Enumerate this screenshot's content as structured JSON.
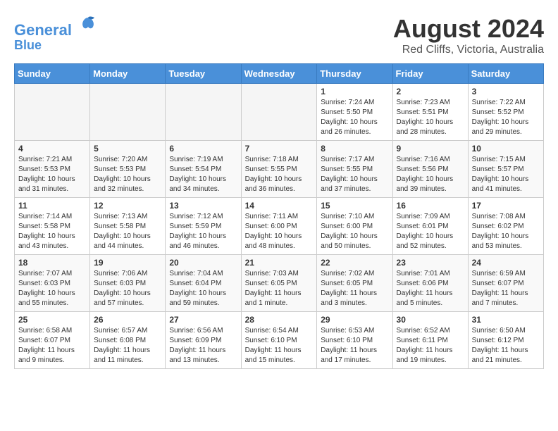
{
  "header": {
    "logo_line1": "General",
    "logo_line2": "Blue",
    "month_year": "August 2024",
    "location": "Red Cliffs, Victoria, Australia"
  },
  "days_of_week": [
    "Sunday",
    "Monday",
    "Tuesday",
    "Wednesday",
    "Thursday",
    "Friday",
    "Saturday"
  ],
  "weeks": [
    [
      {
        "day": "",
        "info": ""
      },
      {
        "day": "",
        "info": ""
      },
      {
        "day": "",
        "info": ""
      },
      {
        "day": "",
        "info": ""
      },
      {
        "day": "1",
        "info": "Sunrise: 7:24 AM\nSunset: 5:50 PM\nDaylight: 10 hours\nand 26 minutes."
      },
      {
        "day": "2",
        "info": "Sunrise: 7:23 AM\nSunset: 5:51 PM\nDaylight: 10 hours\nand 28 minutes."
      },
      {
        "day": "3",
        "info": "Sunrise: 7:22 AM\nSunset: 5:52 PM\nDaylight: 10 hours\nand 29 minutes."
      }
    ],
    [
      {
        "day": "4",
        "info": "Sunrise: 7:21 AM\nSunset: 5:53 PM\nDaylight: 10 hours\nand 31 minutes."
      },
      {
        "day": "5",
        "info": "Sunrise: 7:20 AM\nSunset: 5:53 PM\nDaylight: 10 hours\nand 32 minutes."
      },
      {
        "day": "6",
        "info": "Sunrise: 7:19 AM\nSunset: 5:54 PM\nDaylight: 10 hours\nand 34 minutes."
      },
      {
        "day": "7",
        "info": "Sunrise: 7:18 AM\nSunset: 5:55 PM\nDaylight: 10 hours\nand 36 minutes."
      },
      {
        "day": "8",
        "info": "Sunrise: 7:17 AM\nSunset: 5:55 PM\nDaylight: 10 hours\nand 37 minutes."
      },
      {
        "day": "9",
        "info": "Sunrise: 7:16 AM\nSunset: 5:56 PM\nDaylight: 10 hours\nand 39 minutes."
      },
      {
        "day": "10",
        "info": "Sunrise: 7:15 AM\nSunset: 5:57 PM\nDaylight: 10 hours\nand 41 minutes."
      }
    ],
    [
      {
        "day": "11",
        "info": "Sunrise: 7:14 AM\nSunset: 5:58 PM\nDaylight: 10 hours\nand 43 minutes."
      },
      {
        "day": "12",
        "info": "Sunrise: 7:13 AM\nSunset: 5:58 PM\nDaylight: 10 hours\nand 44 minutes."
      },
      {
        "day": "13",
        "info": "Sunrise: 7:12 AM\nSunset: 5:59 PM\nDaylight: 10 hours\nand 46 minutes."
      },
      {
        "day": "14",
        "info": "Sunrise: 7:11 AM\nSunset: 6:00 PM\nDaylight: 10 hours\nand 48 minutes."
      },
      {
        "day": "15",
        "info": "Sunrise: 7:10 AM\nSunset: 6:00 PM\nDaylight: 10 hours\nand 50 minutes."
      },
      {
        "day": "16",
        "info": "Sunrise: 7:09 AM\nSunset: 6:01 PM\nDaylight: 10 hours\nand 52 minutes."
      },
      {
        "day": "17",
        "info": "Sunrise: 7:08 AM\nSunset: 6:02 PM\nDaylight: 10 hours\nand 53 minutes."
      }
    ],
    [
      {
        "day": "18",
        "info": "Sunrise: 7:07 AM\nSunset: 6:03 PM\nDaylight: 10 hours\nand 55 minutes."
      },
      {
        "day": "19",
        "info": "Sunrise: 7:06 AM\nSunset: 6:03 PM\nDaylight: 10 hours\nand 57 minutes."
      },
      {
        "day": "20",
        "info": "Sunrise: 7:04 AM\nSunset: 6:04 PM\nDaylight: 10 hours\nand 59 minutes."
      },
      {
        "day": "21",
        "info": "Sunrise: 7:03 AM\nSunset: 6:05 PM\nDaylight: 11 hours\nand 1 minute."
      },
      {
        "day": "22",
        "info": "Sunrise: 7:02 AM\nSunset: 6:05 PM\nDaylight: 11 hours\nand 3 minutes."
      },
      {
        "day": "23",
        "info": "Sunrise: 7:01 AM\nSunset: 6:06 PM\nDaylight: 11 hours\nand 5 minutes."
      },
      {
        "day": "24",
        "info": "Sunrise: 6:59 AM\nSunset: 6:07 PM\nDaylight: 11 hours\nand 7 minutes."
      }
    ],
    [
      {
        "day": "25",
        "info": "Sunrise: 6:58 AM\nSunset: 6:07 PM\nDaylight: 11 hours\nand 9 minutes."
      },
      {
        "day": "26",
        "info": "Sunrise: 6:57 AM\nSunset: 6:08 PM\nDaylight: 11 hours\nand 11 minutes."
      },
      {
        "day": "27",
        "info": "Sunrise: 6:56 AM\nSunset: 6:09 PM\nDaylight: 11 hours\nand 13 minutes."
      },
      {
        "day": "28",
        "info": "Sunrise: 6:54 AM\nSunset: 6:10 PM\nDaylight: 11 hours\nand 15 minutes."
      },
      {
        "day": "29",
        "info": "Sunrise: 6:53 AM\nSunset: 6:10 PM\nDaylight: 11 hours\nand 17 minutes."
      },
      {
        "day": "30",
        "info": "Sunrise: 6:52 AM\nSunset: 6:11 PM\nDaylight: 11 hours\nand 19 minutes."
      },
      {
        "day": "31",
        "info": "Sunrise: 6:50 AM\nSunset: 6:12 PM\nDaylight: 11 hours\nand 21 minutes."
      }
    ]
  ]
}
